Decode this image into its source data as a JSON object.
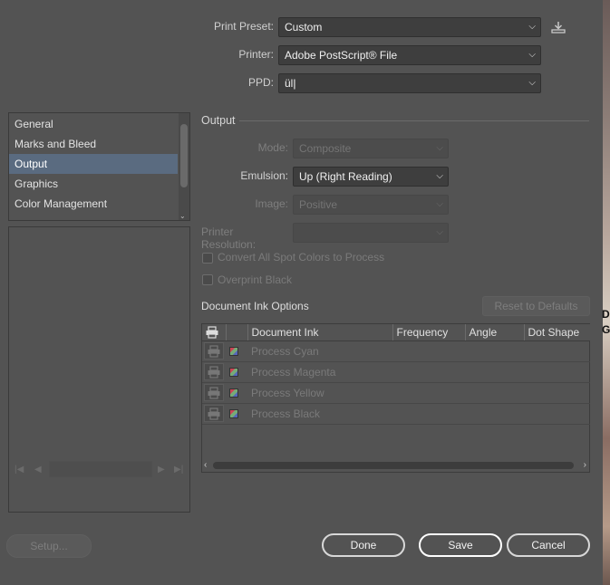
{
  "top": {
    "preset_label": "Print Preset:",
    "preset_value": "Custom",
    "printer_label": "Printer:",
    "printer_value": "Adobe PostScript® File",
    "ppd_label": "PPD:",
    "ppd_value": "ül"
  },
  "categories": {
    "items": [
      "General",
      "Marks and Bleed",
      "Output",
      "Graphics",
      "Color Management"
    ],
    "selected": "Output"
  },
  "output": {
    "title": "Output",
    "mode_label": "Mode:",
    "mode_value": "Composite",
    "emulsion_label": "Emulsion:",
    "emulsion_value": "Up (Right Reading)",
    "image_label": "Image:",
    "image_value": "Positive",
    "resolution_label": "Printer Resolution:",
    "resolution_value": "",
    "convert_spot_label": "Convert All Spot Colors to Process",
    "overprint_black_label": "Overprint Black"
  },
  "inks": {
    "title": "Document Ink Options",
    "reset_label": "Reset to Defaults",
    "columns": [
      "Document Ink",
      "Frequency",
      "Angle",
      "Dot Shape"
    ],
    "rows": [
      "Process Cyan",
      "Process Magenta",
      "Process Yellow",
      "Process Black"
    ]
  },
  "buttons": {
    "setup": "Setup...",
    "done": "Done",
    "save": "Save",
    "cancel": "Cancel"
  },
  "edge_text": [
    "D",
    "G"
  ],
  "colors": {
    "dialog_bg": "#535353",
    "selection": "#5a6b80",
    "field_bg": "#3e3e3e"
  }
}
